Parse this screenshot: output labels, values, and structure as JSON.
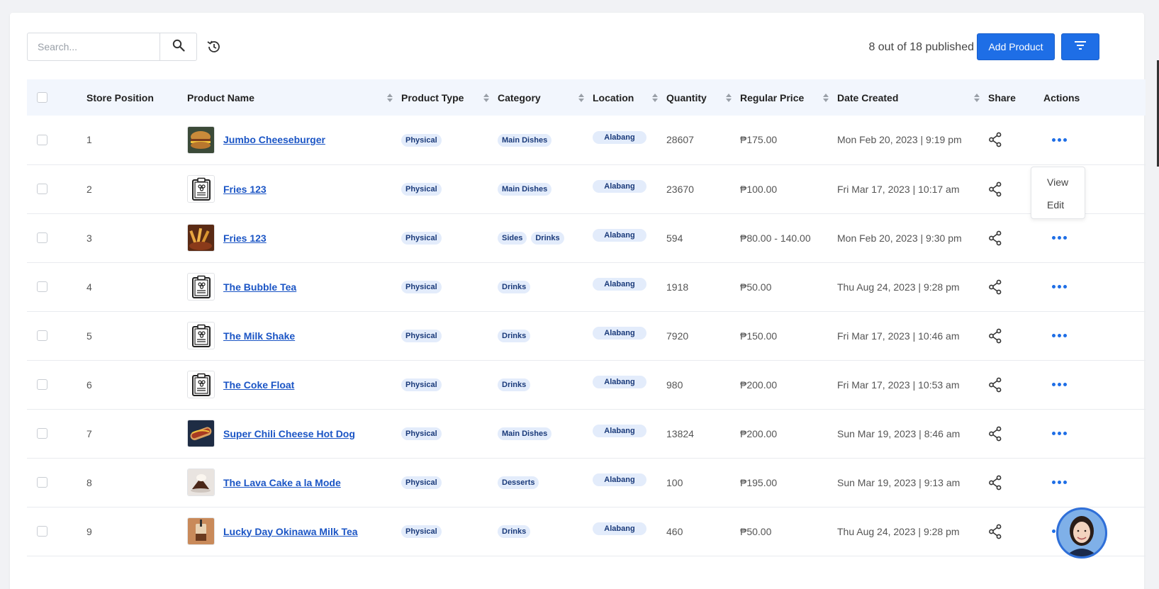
{
  "toolbar": {
    "search_placeholder": "Search...",
    "published_text": "8 out of 18 published",
    "add_product_label": "Add Product"
  },
  "table": {
    "headers": {
      "store_position": "Store Position",
      "product_name": "Product Name",
      "product_type": "Product Type",
      "category": "Category",
      "location": "Location",
      "quantity": "Quantity",
      "regular_price": "Regular Price",
      "date_created": "Date Created",
      "share": "Share",
      "actions": "Actions"
    },
    "rows": [
      {
        "pos": "1",
        "name": "Jumbo Cheeseburger",
        "thumb": "burger",
        "type": "Physical",
        "categories": [
          "Main Dishes"
        ],
        "location": "Alabang",
        "quantity": "28607",
        "price": "₱175.00",
        "date": "Mon Feb 20, 2023 | 9:19 pm"
      },
      {
        "pos": "2",
        "name": "Fries 123",
        "thumb": "clipboard",
        "type": "Physical",
        "categories": [
          "Main Dishes"
        ],
        "location": "Alabang",
        "quantity": "23670",
        "price": "₱100.00",
        "date": "Fri Mar 17, 2023 | 10:17 am"
      },
      {
        "pos": "3",
        "name": "Fries 123",
        "thumb": "fries",
        "type": "Physical",
        "categories": [
          "Sides",
          "Drinks"
        ],
        "location": "Alabang",
        "quantity": "594",
        "price": "₱80.00 - 140.00",
        "date": "Mon Feb 20, 2023 | 9:30 pm"
      },
      {
        "pos": "4",
        "name": "The Bubble Tea",
        "thumb": "clipboard",
        "type": "Physical",
        "categories": [
          "Drinks"
        ],
        "location": "Alabang",
        "quantity": "1918",
        "price": "₱50.00",
        "date": "Thu Aug 24, 2023 | 9:28 pm"
      },
      {
        "pos": "5",
        "name": "The Milk Shake",
        "thumb": "clipboard",
        "type": "Physical",
        "categories": [
          "Drinks"
        ],
        "location": "Alabang",
        "quantity": "7920",
        "price": "₱150.00",
        "date": "Fri Mar 17, 2023 | 10:46 am"
      },
      {
        "pos": "6",
        "name": "The Coke Float",
        "thumb": "clipboard",
        "type": "Physical",
        "categories": [
          "Drinks"
        ],
        "location": "Alabang",
        "quantity": "980",
        "price": "₱200.00",
        "date": "Fri Mar 17, 2023 | 10:53 am"
      },
      {
        "pos": "7",
        "name": "Super Chili Cheese Hot Dog",
        "thumb": "hotdog",
        "type": "Physical",
        "categories": [
          "Main Dishes"
        ],
        "location": "Alabang",
        "quantity": "13824",
        "price": "₱200.00",
        "date": "Sun Mar 19, 2023 | 8:46 am"
      },
      {
        "pos": "8",
        "name": "The Lava Cake a la Mode",
        "thumb": "cake",
        "type": "Physical",
        "categories": [
          "Desserts"
        ],
        "location": "Alabang",
        "quantity": "100",
        "price": "₱195.00",
        "date": "Sun Mar 19, 2023 | 9:13 am"
      },
      {
        "pos": "9",
        "name": "Lucky Day Okinawa Milk Tea",
        "thumb": "milktea",
        "type": "Physical",
        "categories": [
          "Drinks"
        ],
        "location": "Alabang",
        "quantity": "460",
        "price": "₱50.00",
        "date": "Thu Aug 24, 2023 | 9:28 pm"
      }
    ]
  },
  "action_menu": {
    "row": "1",
    "items": [
      "View",
      "Edit"
    ]
  },
  "colors": {
    "accent": "#1e6ee6",
    "link": "#1b55c5",
    "tag_bg": "#e3ecfb",
    "header_bg": "#f2f6fd"
  }
}
